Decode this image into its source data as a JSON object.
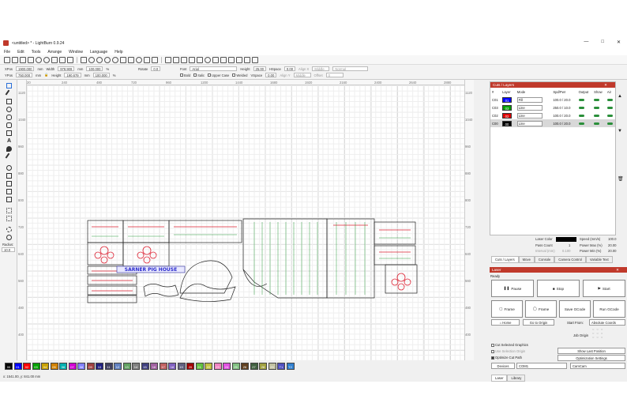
{
  "window": {
    "title": "<untitled> * - LightBurn 0.9.24",
    "min": "—",
    "max": "□",
    "close": "✕"
  },
  "menu": [
    "File",
    "Edit",
    "Tools",
    "Arrange",
    "Window",
    "Language",
    "Help"
  ],
  "options": {
    "xpos_label": "XPos",
    "xpos": "1900.000",
    "ypos_label": "YPos",
    "ypos": "750.000",
    "mm": "mm",
    "width_label": "Width",
    "width": "978.909",
    "height_label": "Height",
    "height": "190.679",
    "scale_w": "100.000",
    "scale_h": "100.000",
    "pct": "%",
    "rotate_label": "Rotate",
    "rotate": "0.0",
    "font_label": "Font",
    "font": "Arial",
    "fheight_label": "Height",
    "fheight": "25.00",
    "hspace_label": "HSpace",
    "hspace": "0.00",
    "vspace_label": "VSpace",
    "vspace": "0.00",
    "alignx_label": "Align X",
    "alignx": "Middle",
    "aligny_label": "Align Y",
    "aligny": "Middle",
    "normal": "Normal",
    "offset_label": "Offset",
    "offset": "0",
    "bold": "Bold",
    "italic": "Italic",
    "upper": "Upper Case",
    "welded": "Welded"
  },
  "left_tools": {
    "radius_label": "Radius:",
    "radius": "10.0"
  },
  "rulers": {
    "top": [
      "20",
      "240",
      "480",
      "720",
      "960",
      "1200",
      "1440",
      "1680",
      "1920",
      "2160",
      "2400",
      "2640",
      "2880"
    ],
    "left": [
      "1120",
      "1040",
      "960",
      "880",
      "800",
      "720",
      "640",
      "560",
      "480",
      "400"
    ]
  },
  "artwork": {
    "sign_text": "SARNER PIG HOUSE"
  },
  "cuts": {
    "title": "Cuts / Layers",
    "headers": [
      "#",
      "Layer",
      "Mode",
      "Spd/Pwr",
      "Output",
      "Show",
      "Air"
    ],
    "rows": [
      {
        "num": "C01",
        "layer": "01",
        "color": "#0000ff",
        "mode": "Fill",
        "spd": "100.0 / 20.0"
      },
      {
        "num": "C03",
        "layer": "03",
        "color": "#00a000",
        "mode": "Line",
        "spd": "250.0 / 10.0"
      },
      {
        "num": "C02",
        "layer": "02",
        "color": "#e00000",
        "mode": "Line",
        "spd": "100.0 / 20.0"
      },
      {
        "num": "C00",
        "layer": "00",
        "color": "#000000",
        "mode": "Line",
        "spd": "100.0 / 20.0"
      }
    ],
    "layer_color_label": "Laser Color",
    "speed_label": "Speed (mm/s)",
    "speed": "100.0",
    "pass_label": "Pass Count",
    "pass": "1",
    "pmax_label": "Power Max (%)",
    "pmax": "20.00",
    "interval_label": "Interval (mm)",
    "interval": "0.100",
    "pmin_label": "Power Min (%)",
    "pmin": "20.00",
    "tabs": [
      "Cuts / Layers",
      "Move",
      "Console",
      "Camera Control",
      "Variable Text"
    ]
  },
  "laser": {
    "title": "Laser",
    "status": "Ready",
    "pause": "Pause",
    "stop": "Stop",
    "start": "Start",
    "frame1": "Frame",
    "frame2": "Frame",
    "save": "Save GCode",
    "run": "Run GCode",
    "home": "Home",
    "goto": "Go to Origin",
    "start_from_label": "Start From:",
    "start_from": "Absolute Coords",
    "job_origin": "Job Origin",
    "cut_selected": "Cut Selected Graphics",
    "use_selection": "Use Selection Origin",
    "optimize": "Optimize Cut Path",
    "show_last": "Show Last Position",
    "opt_settings": "Optimization Settings",
    "devices": "Devices",
    "port": "COM1",
    "device": "CamCam",
    "tabs": [
      "Laser",
      "Library"
    ]
  },
  "palette": [
    {
      "t": "00",
      "c": "#000000"
    },
    {
      "t": "01",
      "c": "#0000ff"
    },
    {
      "t": "02",
      "c": "#ff0000"
    },
    {
      "t": "03",
      "c": "#00a000"
    },
    {
      "t": "04",
      "c": "#c8a000"
    },
    {
      "t": "05",
      "c": "#d08000"
    },
    {
      "t": "06",
      "c": "#00b0b0"
    },
    {
      "t": "07",
      "c": "#d000d0"
    },
    {
      "t": "08",
      "c": "#8080ff"
    },
    {
      "t": "09",
      "c": "#a04040"
    },
    {
      "t": "10",
      "c": "#202080"
    },
    {
      "t": "11",
      "c": "#404060"
    },
    {
      "t": "12",
      "c": "#6080c0"
    },
    {
      "t": "13",
      "c": "#60a060"
    },
    {
      "t": "14",
      "c": "#808080"
    },
    {
      "t": "15",
      "c": "#404080"
    },
    {
      "t": "16",
      "c": "#a060a0"
    },
    {
      "t": "17",
      "c": "#c06060"
    },
    {
      "t": "18",
      "c": "#8060c0"
    },
    {
      "t": "19",
      "c": "#606080"
    },
    {
      "t": "20",
      "c": "#a00000"
    },
    {
      "t": "21",
      "c": "#60c040"
    },
    {
      "t": "22",
      "c": "#c0c040"
    },
    {
      "t": "23",
      "c": "#f080c0"
    },
    {
      "t": "24",
      "c": "#e050e0"
    },
    {
      "t": "25",
      "c": "#80c080"
    },
    {
      "t": "26",
      "c": "#604020"
    },
    {
      "t": "27",
      "c": "#406040"
    },
    {
      "t": "28",
      "c": "#a0a040"
    },
    {
      "t": "29",
      "c": "#c0c0a0"
    },
    {
      "t": "T1",
      "c": "#5050c0"
    },
    {
      "t": "T2",
      "c": "#3080d0"
    }
  ],
  "status": {
    "coords": "x: 1541.00, y: 841.00 mm"
  }
}
